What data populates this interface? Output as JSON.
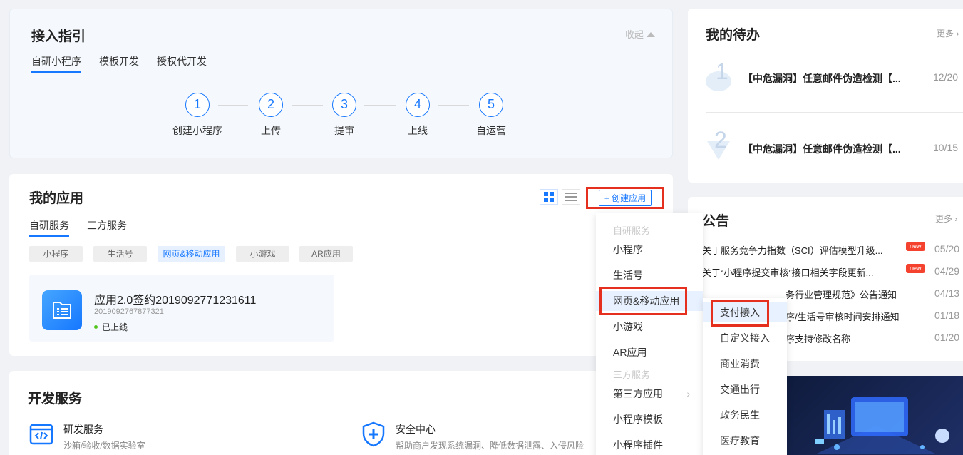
{
  "guide": {
    "title": "接入指引",
    "collapse": "收起",
    "tabs": [
      "自研小程序",
      "模板开发",
      "授权代开发"
    ],
    "steps": [
      {
        "num": "1",
        "label": "创建小程序"
      },
      {
        "num": "2",
        "label": "上传"
      },
      {
        "num": "3",
        "label": "提审"
      },
      {
        "num": "4",
        "label": "上线"
      },
      {
        "num": "5",
        "label": "自运营"
      }
    ]
  },
  "apps": {
    "title": "我的应用",
    "create_label": "+ 创建应用",
    "tabs": [
      "自研服务",
      "三方服务"
    ],
    "filters": [
      "小程序",
      "生活号",
      "网页&移动应用",
      "小游戏",
      "AR应用"
    ],
    "item": {
      "name": "应用2.0签约2019092771231611",
      "id": "2019092767877321",
      "status": "已上线"
    }
  },
  "dev": {
    "title": "开发服务",
    "services": [
      {
        "name": "研发服务",
        "desc": "沙箱/验收/数据实验室"
      },
      {
        "name": "安全中心",
        "desc": "帮助商户发现系统漏洞、降低数据泄露、入侵风险"
      }
    ]
  },
  "todo": {
    "title": "我的待办",
    "more": "更多",
    "items": [
      {
        "rank": "1",
        "text": "【中危漏洞】任意邮件伪造检测【...",
        "date": "12/20"
      },
      {
        "rank": "2",
        "text": "【中危漏洞】任意邮件伪造检测【...",
        "date": "10/15"
      }
    ]
  },
  "notice": {
    "title": "公告",
    "more": "更多",
    "new_label": "new",
    "items": [
      {
        "text": "关于服务竞争力指数（SCI）评估模型升级...",
        "date": "05/20"
      },
      {
        "text": "关于“小程序提交审核”接口相关字段更新...",
        "date": "04/29"
      },
      {
        "text": "务行业管理规范》公告通知",
        "date": "04/13"
      },
      {
        "text": "序/生活号审核时间安排通知",
        "date": "01/18"
      },
      {
        "text": "序支持修改名称",
        "date": "01/20"
      }
    ]
  },
  "dropdown1": {
    "group1": "自研服务",
    "items1": [
      "小程序",
      "生活号",
      "网页&移动应用",
      "小游戏",
      "AR应用"
    ],
    "group2": "三方服务",
    "items2": [
      "第三方应用",
      "小程序模板",
      "小程序插件"
    ]
  },
  "dropdown2": {
    "items": [
      "支付接入",
      "自定义接入",
      "商业消费",
      "交通出行",
      "政务民生",
      "医疗教育"
    ]
  },
  "colors": {
    "accent": "#1677ff",
    "highlight": "#e53020",
    "new_badge": "#f5422f"
  }
}
